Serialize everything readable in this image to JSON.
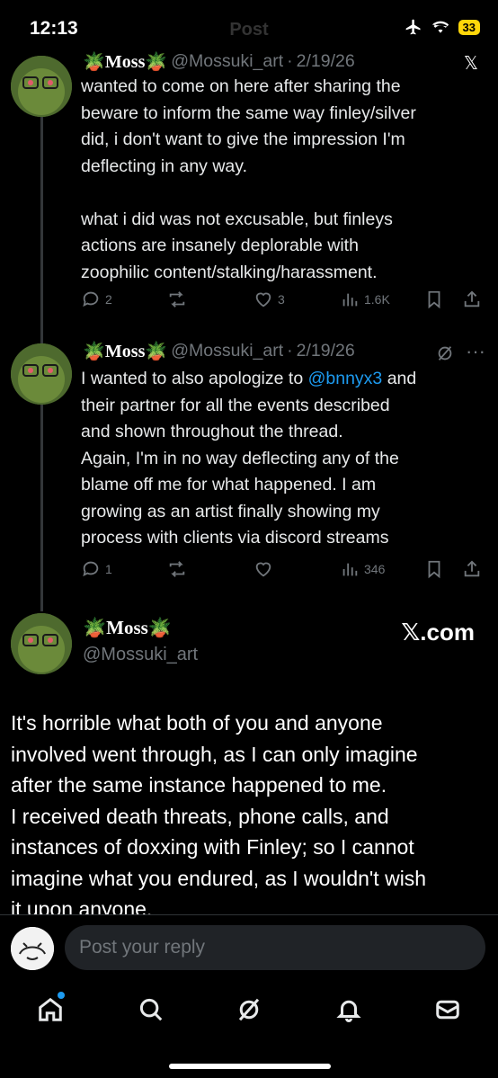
{
  "status_bar": {
    "time": "12:13",
    "battery": "33"
  },
  "header": {
    "title": "Post"
  },
  "posts": [
    {
      "name": "🪴Moss🪴",
      "handle": "@Mossuki_art",
      "date": "2/19/26",
      "text_lines": [
        "wanted to come on here after sharing the",
        "beware to inform the same way finley/silver",
        "did, i don't want to give the impression I'm",
        "deflecting in any way.",
        "",
        "what i did was not excusable, but finleys",
        "actions are insanely deplorable with",
        "zoophilic content/stalking/harassment."
      ],
      "replies": "2",
      "reposts": "",
      "likes": "3",
      "views": "1.6K"
    },
    {
      "name": "🪴Moss🪴",
      "handle": "@Mossuki_art",
      "date": "2/19/26",
      "text_lines": [
        "I wanted to also apologize to",
        "@bnnyx3",
        "and",
        "their partner for all the events described",
        "and shown throughout the thread.",
        "Again, I'm in no way deflecting any of the",
        "blame off me for what happened. I am",
        "growing as an artist finally showing my",
        "process with clients via discord streams"
      ],
      "replies": "1",
      "reposts": "",
      "likes": "",
      "views": "346"
    }
  ],
  "quoted": {
    "name": "🪴Moss🪴",
    "handle": "@Mossuki_art",
    "source": "𝕏.com",
    "text_lines": [
      "It's horrible what both of you and anyone",
      "involved went through, as I can only imagine",
      "after the same instance happened to me.",
      "I received death threats, phone calls, and",
      "instances of doxxing with Finley; so I cannot",
      "imagine what you endured, as I wouldn't wish",
      "it upon anyone."
    ]
  },
  "reply": {
    "placeholder": "Post your reply"
  },
  "colors": {
    "accent": "#1d9bf0",
    "background": "#000000",
    "muted": "#71767b"
  },
  "tabs": [
    "home-icon",
    "search-icon",
    "grok-icon",
    "notifications-icon",
    "messages-icon"
  ]
}
